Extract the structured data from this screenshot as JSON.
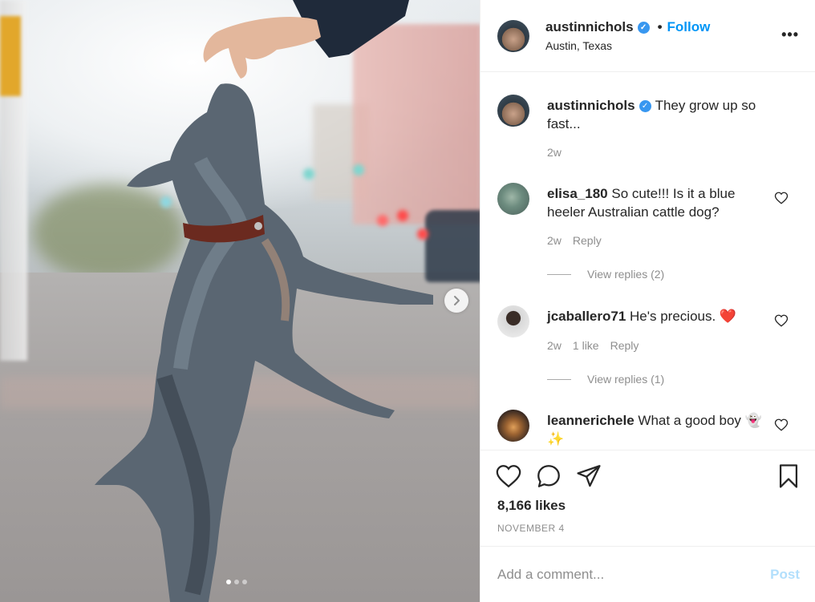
{
  "post": {
    "username": "austinnichols",
    "verified": true,
    "follow_label": "Follow",
    "bullet": "•",
    "location": "Austin, Texas",
    "more_label": "•••",
    "caption": "They grow up so fast...",
    "caption_time": "2w",
    "likes": "8,166 likes",
    "date": "NOVEMBER 4",
    "carousel": {
      "slides": 3,
      "active": 1
    }
  },
  "comments": [
    {
      "user": "elisa_180",
      "text": "So cute!!! Is it a blue heeler Australian cattle dog?",
      "time": "2w",
      "likes": "",
      "reply": "Reply",
      "view_replies": "View replies (2)"
    },
    {
      "user": "jcaballero71",
      "text": "He's precious. ❤️",
      "time": "2w",
      "likes": "1 like",
      "reply": "Reply",
      "view_replies": "View replies (1)"
    },
    {
      "user": "leannerichele",
      "text": "What a good boy 👻✨",
      "time": "",
      "likes": "",
      "reply": "",
      "view_replies": ""
    }
  ],
  "add_comment": {
    "placeholder": "Add a comment...",
    "post_label": "Post"
  },
  "colors": {
    "accent": "#0095f6",
    "verified": "#3897f0",
    "muted": "#8e8e8e",
    "heart": "#ed4956",
    "post_disabled": "#b2dffc"
  },
  "icons": [
    "chevron-right-icon",
    "more-icon",
    "verified-icon",
    "heart-icon",
    "comment-icon",
    "share-icon",
    "bookmark-icon"
  ]
}
